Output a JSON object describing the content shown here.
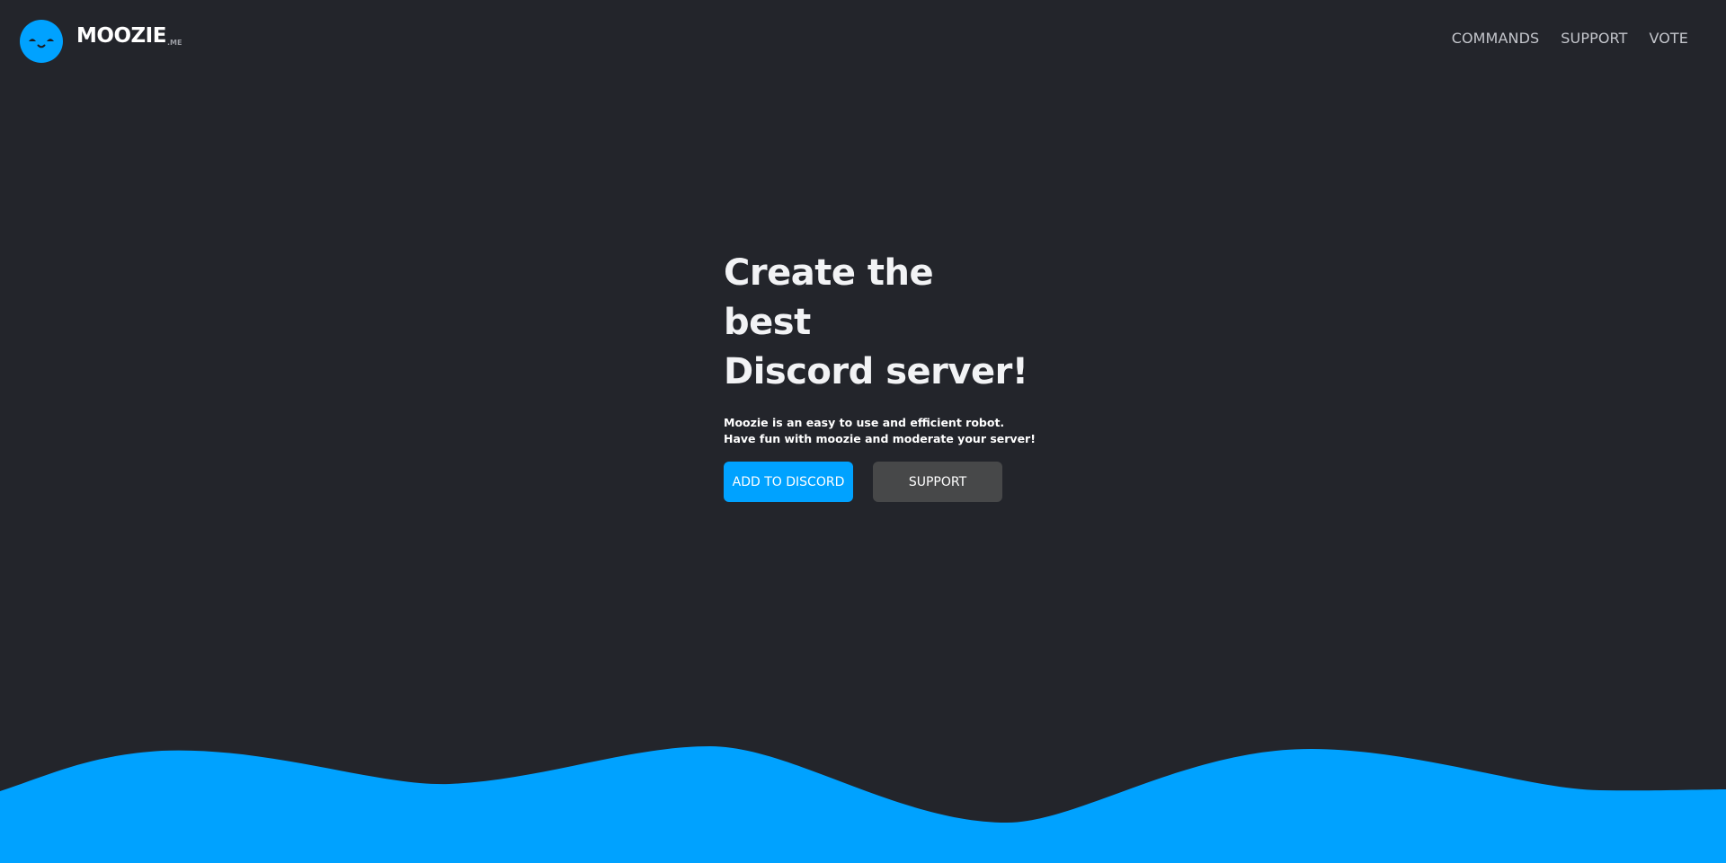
{
  "colors": {
    "background": "#23252b",
    "accent": "#00a2ff",
    "secondary_button": "#474849",
    "nav_text": "#c4c6cc"
  },
  "header": {
    "logo_icon": "smiling-face-icon",
    "brand_name": "MOOZIE",
    "brand_tld": ".ME",
    "nav": {
      "commands": "COMMANDS",
      "support": "SUPPORT",
      "vote": "VOTE"
    }
  },
  "hero": {
    "title_line1": "Create the best",
    "title_line2": "Discord server!",
    "description_line1": "Moozie is an easy to use and efficient robot.",
    "description_line2": "Have fun with moozie and moderate your server!",
    "add_button_label": "ADD TO DISCORD",
    "support_button_label": "SUPPORT"
  },
  "decoration": {
    "wave": "blue-wave-graphic"
  }
}
